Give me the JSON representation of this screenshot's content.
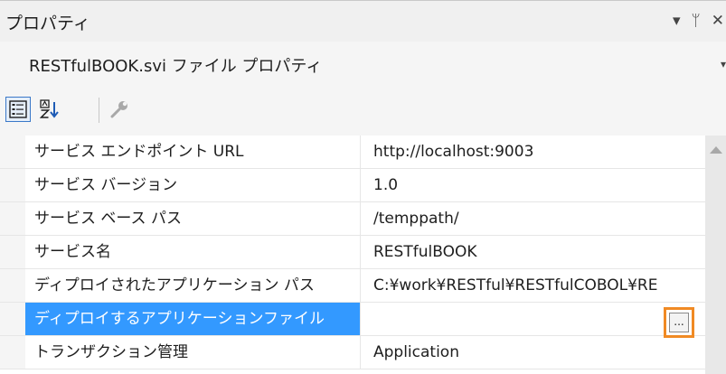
{
  "window": {
    "title": "プロパティ",
    "dropdown_glyph": "▾",
    "pin_glyph": "ᛘ",
    "close_glyph": "✕"
  },
  "object_selector": {
    "label": "RESTfulBOOK.svi ファイル プロパティ",
    "dropdown_glyph": "▾"
  },
  "toolbar": {
    "categorized_icon": "categorized-icon",
    "alphabetical_icon": "alphabetical-sort-icon",
    "property_pages_icon": "wrench-icon"
  },
  "properties": [
    {
      "name": "サービス エンドポイント URL",
      "value": "http://localhost:9003"
    },
    {
      "name": "サービス バージョン",
      "value": "1.0"
    },
    {
      "name": "サービス ベース パス",
      "value": "/temppath/"
    },
    {
      "name": "サービス名",
      "value": "RESTfulBOOK"
    },
    {
      "name": "ディプロイされたアプリケーション パス",
      "value": "C:¥work¥RESTful¥RESTfulCOBOL¥RE"
    },
    {
      "name": "ディプロイするアプリケーションファイル",
      "value": ""
    },
    {
      "name": "トランザクション管理",
      "value": "Application"
    }
  ],
  "selected_row_index": 5,
  "ellipsis_button_label": "...",
  "colors": {
    "selection": "#3399ff",
    "highlight_border": "#f08a24"
  }
}
